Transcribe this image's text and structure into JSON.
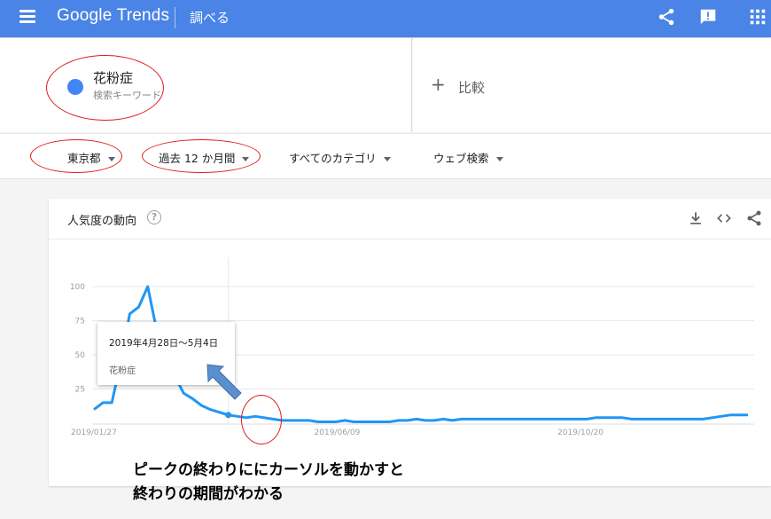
{
  "header": {
    "logo": "Google Trends",
    "section": "調べる",
    "icons": [
      "menu-icon",
      "share-icon",
      "feedback-icon",
      "apps-icon"
    ]
  },
  "search": {
    "term": "花粉症",
    "term_type": "検索キーワード",
    "term_color": "#4285f4",
    "compare_label": "比較"
  },
  "filters": [
    {
      "label": "東京都"
    },
    {
      "label": "過去 12 か月間"
    },
    {
      "label": "すべてのカテゴリ"
    },
    {
      "label": "ウェブ検索"
    }
  ],
  "chart_card": {
    "title": "人気度の動向",
    "icons": [
      "help-icon",
      "download-icon",
      "embed-icon",
      "share-icon"
    ]
  },
  "chart_data": {
    "type": "line",
    "series": [
      {
        "name": "花粉症",
        "color": "#2196f3",
        "values": [
          10,
          15,
          15,
          45,
          80,
          85,
          100,
          68,
          50,
          35,
          22,
          18,
          13,
          10,
          8,
          6,
          5,
          4,
          5,
          4,
          3,
          2,
          2,
          2,
          2,
          1,
          1,
          1,
          2,
          1,
          1,
          1,
          1,
          1,
          2,
          2,
          3,
          2,
          2,
          3,
          2,
          3,
          3,
          3,
          3,
          3,
          3,
          3,
          3,
          3,
          3,
          3,
          3,
          3,
          3,
          3,
          4,
          4,
          4,
          4,
          3,
          3,
          3,
          3,
          3,
          3,
          3,
          3,
          3,
          4,
          5,
          6,
          6,
          6
        ]
      }
    ],
    "x_tick_labels": [
      "2019/01/27",
      "2019/06/09",
      "2019/10/20"
    ],
    "y_ticks": [
      25,
      50,
      75,
      100
    ],
    "ylim": [
      0,
      100
    ],
    "grid": true,
    "hover_index": 15
  },
  "tooltip": {
    "date": "2019年4月28日～5月4日",
    "term": "花粉症"
  },
  "annotation": {
    "line1": "ピークの終わりににカーソルを動かすと",
    "line2": "終わりの期間がわかる",
    "color": "#e01b1b"
  }
}
